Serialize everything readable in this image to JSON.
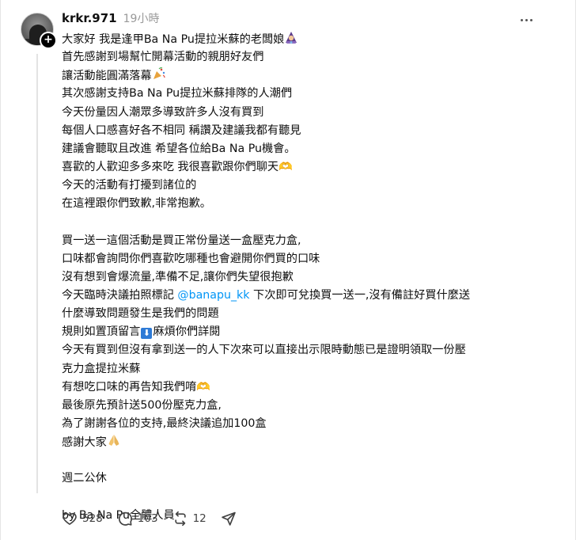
{
  "post": {
    "username": "krkr.971",
    "time": "19小時",
    "lines": [
      {
        "text": "大家好 我是逢甲Ba Na Pu提拉米蘇的老闆娘",
        "emoji": "fortune-teller"
      },
      {
        "text": "首先感謝到場幫忙開幕活動的親朋好友們"
      },
      {
        "text": "讓活動能圓滿落幕",
        "emoji": "party-popper"
      },
      {
        "text": "其次感謝支持Ba Na Pu提拉米蘇排隊的人潮們"
      },
      {
        "text": "今天份量因人潮眾多導致許多人沒有買到"
      },
      {
        "text": "每個人口感喜好各不相同 稱讚及建議我都有聽見"
      },
      {
        "text": "建議會聽取且改進 希望各位給Ba Na Pu機會。"
      },
      {
        "text": "喜歡的人歡迎多多來吃 我很喜歡跟你們聊天🫶"
      },
      {
        "text": "今天的活動有打擾到諸位的"
      },
      {
        "text": "在這裡跟你們致歉,非常抱歉。"
      },
      {
        "text": ""
      },
      {
        "text": "買一送一這個活動是買正常份量送一盒壓克力盒,"
      },
      {
        "text": "口味都會詢問你們喜歡吃哪種也會避開你們買的口味"
      },
      {
        "text": "沒有想到會爆流量,準備不足,讓你們失望很抱歉"
      },
      {
        "text": "今天臨時決議拍照標記 ",
        "mention": "@banapu_kk",
        "after": " 下次即可兌換買一送一,沒有備註好買什麼送"
      },
      {
        "text": "什麼導致問題發生是我們的問題"
      },
      {
        "text": "規則如置頂留言",
        "arrow": "⬇",
        "after": "麻煩你們詳閱"
      },
      {
        "text": "今天有買到但沒有拿到送一的人下次來可以直接出示限時動態已是證明領取一份壓"
      },
      {
        "text": "克力盒提拉米蘇"
      },
      {
        "text": "有想吃口味的再告知我們唷🫶"
      },
      {
        "text": "最後原先預計送500份壓克力盒,"
      },
      {
        "text": "為了謝謝各位的支持,最終決議追加100盒"
      },
      {
        "text": "感謝大家",
        "emoji": "folded-hands"
      },
      {
        "text": ""
      },
      {
        "text": "週二公休"
      },
      {
        "text": ""
      },
      {
        "text": "by Ba Na Pu全體人員"
      }
    ]
  },
  "actions": {
    "likes": "528",
    "comments": "103",
    "reposts": "12"
  },
  "colors": {
    "mention": "#0095f6",
    "muted": "#999999",
    "text": "#101010"
  }
}
